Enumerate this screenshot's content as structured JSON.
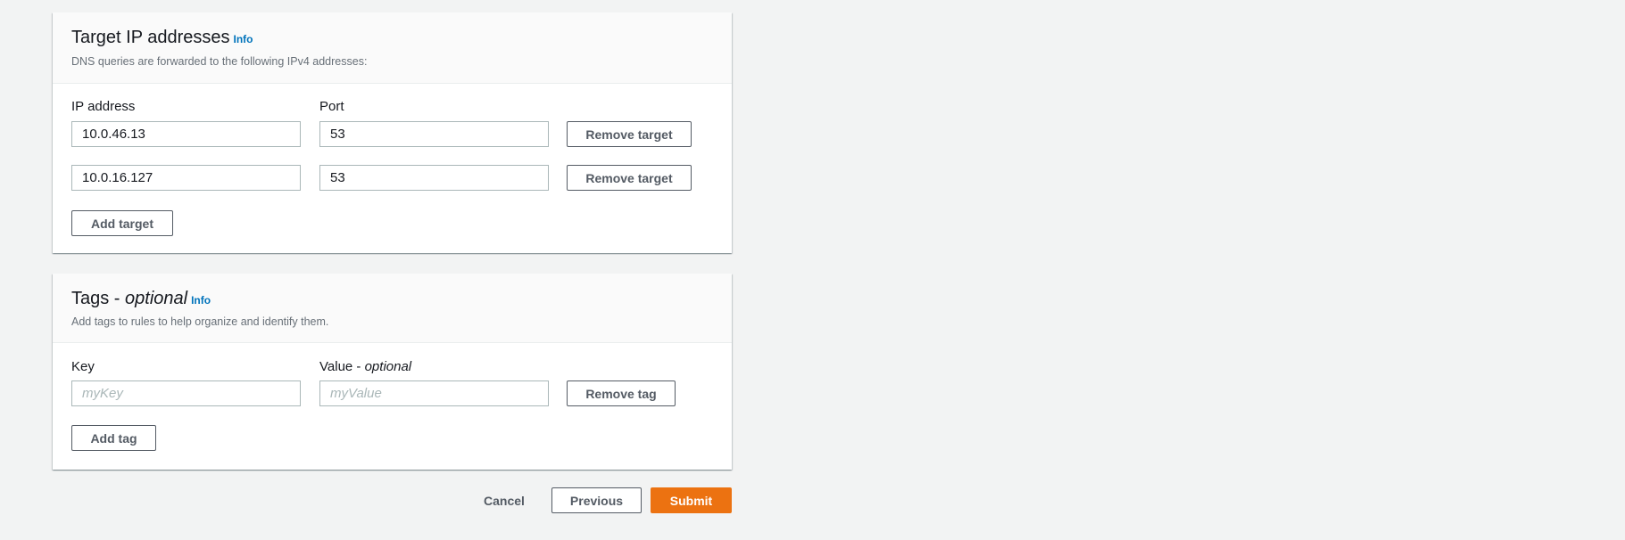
{
  "targets": {
    "title": "Target IP addresses",
    "info": "Info",
    "description": "DNS queries are forwarded to the following IPv4 addresses:",
    "ip_label": "IP address",
    "port_label": "Port",
    "rows": [
      {
        "ip": "10.0.46.13",
        "port": "53",
        "remove": "Remove target"
      },
      {
        "ip": "10.0.16.127",
        "port": "53",
        "remove": "Remove target"
      }
    ],
    "add": "Add target"
  },
  "tags": {
    "title": "Tags - ",
    "title_optional": "optional",
    "info": "Info",
    "description": "Add tags to rules to help organize and identify them.",
    "key_label": "Key",
    "value_label": "Value - ",
    "value_optional": "optional",
    "key_placeholder": "myKey",
    "value_placeholder": "myValue",
    "remove": "Remove tag",
    "add": "Add tag"
  },
  "footer": {
    "cancel": "Cancel",
    "previous": "Previous",
    "submit": "Submit"
  },
  "colors": {
    "primary": "#ec7211",
    "link": "#0073bb"
  }
}
